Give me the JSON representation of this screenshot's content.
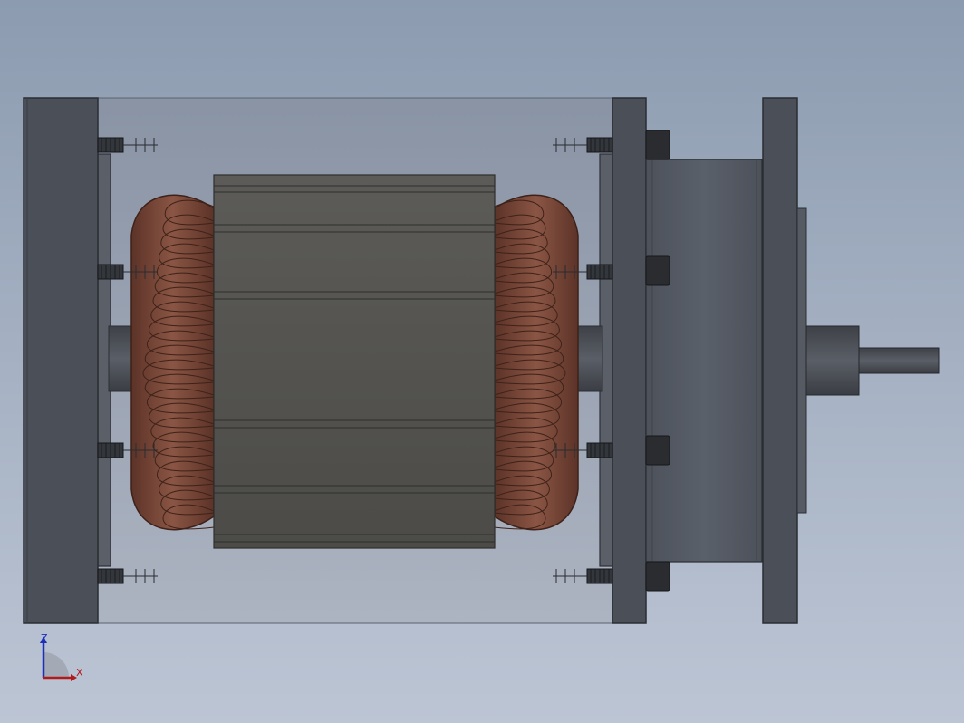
{
  "viewport": {
    "background_top": "#8c9bb0",
    "background_bottom": "#bcc5d4"
  },
  "model": {
    "description_icon": "motor-assembly-model",
    "colors": {
      "plate": "#4a4f58",
      "plate_edge": "#2b2e33",
      "housing_glass": "#9aa3b2",
      "stator": "#5d5c59",
      "stator_edge": "#2e2e2c",
      "copper": "#7a4a3c",
      "copper_dark": "#4d2b22",
      "flange": "#565b64",
      "shaft": "#4b4e55",
      "bolt": "#2a2c30"
    }
  },
  "triad": {
    "z_label": "Z",
    "x_label": "X",
    "z_color": "#1c2fb8",
    "x_color": "#b01a1a"
  }
}
